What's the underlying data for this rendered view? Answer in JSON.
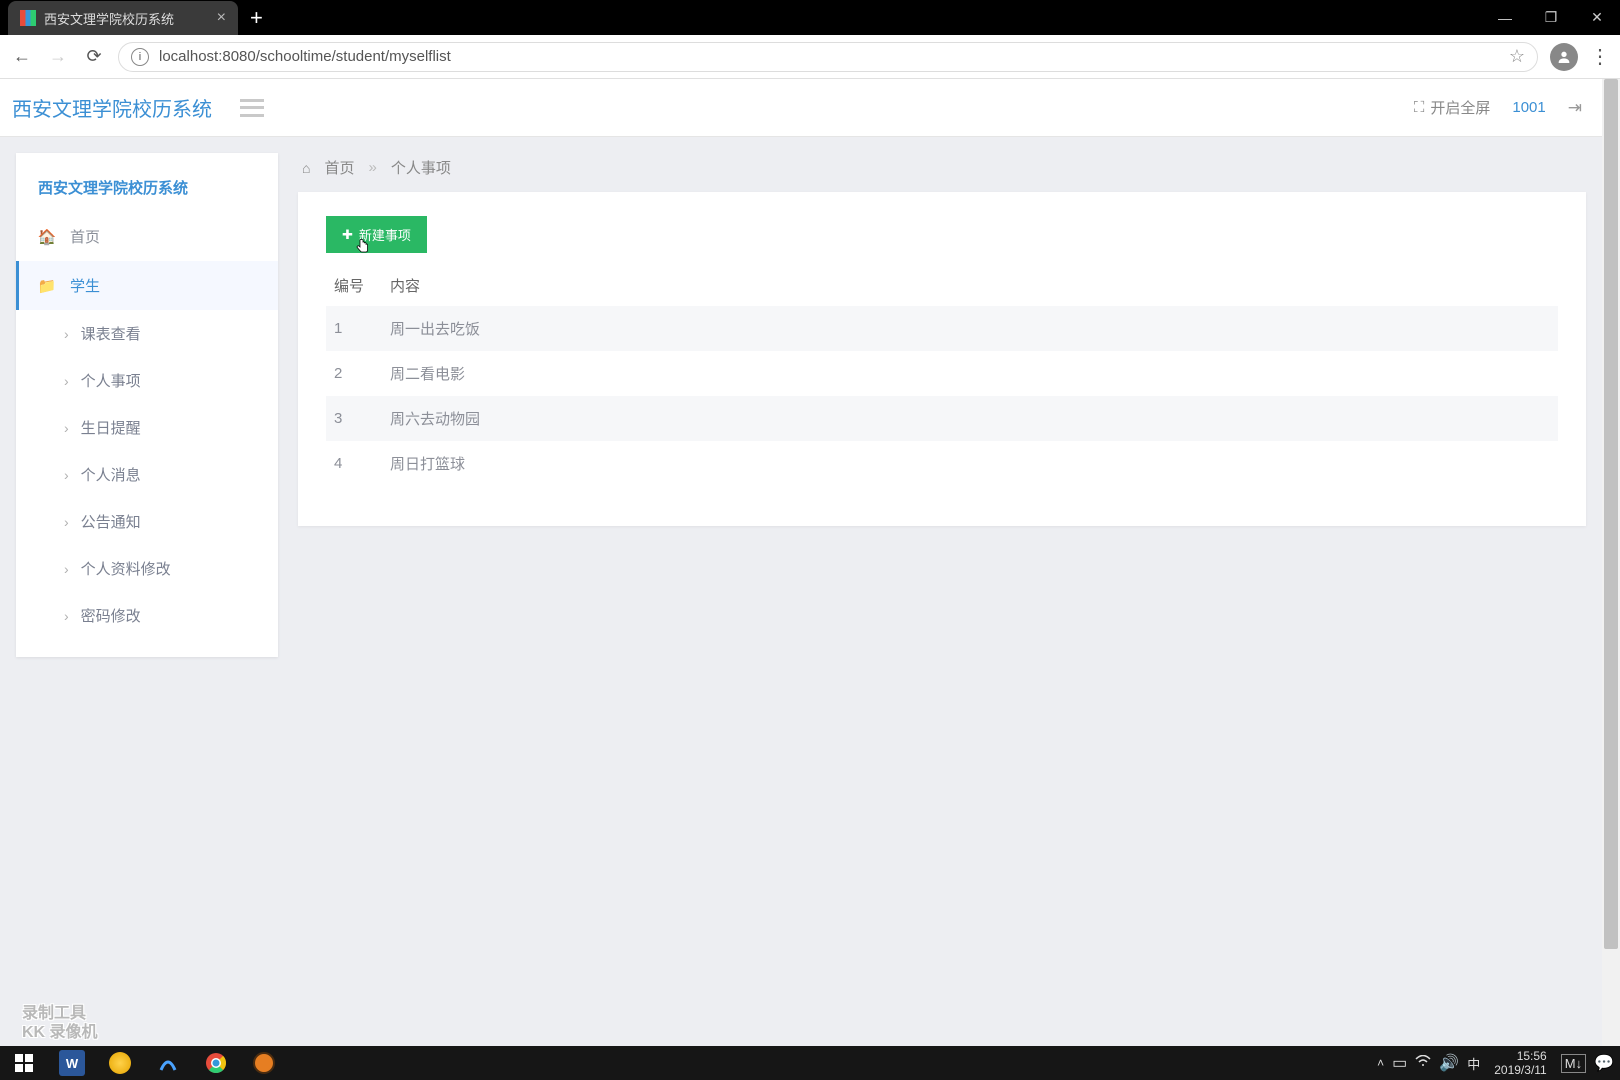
{
  "browser": {
    "tab_title": "西安文理学院校历系统",
    "url": "localhost:8080/schooltime/student/myselflist"
  },
  "window_controls": {
    "min": "—",
    "max": "❐",
    "close": "✕"
  },
  "header": {
    "brand": "西安文理学院校历系统",
    "fullscreen_label": "开启全屏",
    "user_id": "1001"
  },
  "sidebar": {
    "title": "西安文理学院校历系统",
    "home": "首页",
    "student": "学生",
    "subs": [
      "课表查看",
      "个人事项",
      "生日提醒",
      "个人消息",
      "公告通知",
      "个人资料修改",
      "密码修改"
    ]
  },
  "breadcrumb": {
    "home": "首页",
    "current": "个人事项"
  },
  "main": {
    "add_btn": "新建事项",
    "col_id": "编号",
    "col_content": "内容",
    "rows": [
      {
        "id": "1",
        "content": "周一出去吃饭"
      },
      {
        "id": "2",
        "content": "周二看电影"
      },
      {
        "id": "3",
        "content": "周六去动物园"
      },
      {
        "id": "4",
        "content": "周日打篮球"
      }
    ]
  },
  "watermark": {
    "l1": "录制工具",
    "l2": "KK 录像机"
  },
  "taskbar": {
    "time": "15:56",
    "date": "2019/3/11",
    "ime": "中"
  }
}
